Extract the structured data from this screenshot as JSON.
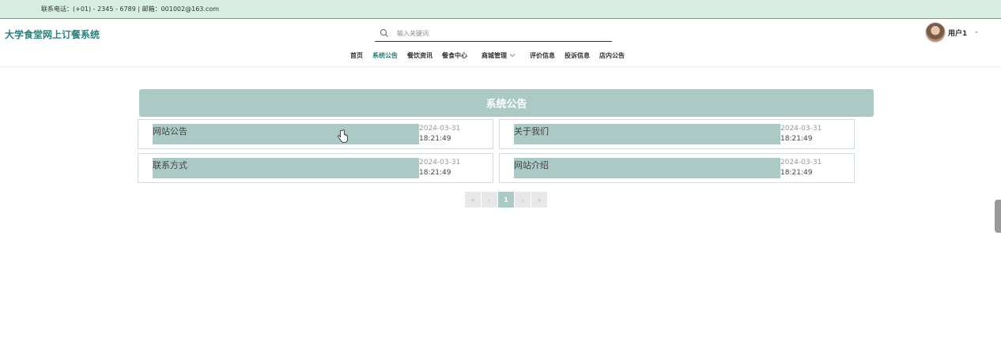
{
  "topbar": {
    "contact": "联系电话：(+01) - 2345 - 6789 | 邮箱：001002@163.com"
  },
  "header": {
    "site_title": "大学食堂网上订餐系统",
    "search_placeholder": "输入关键词",
    "user_name": "用户1",
    "user_caret": "-"
  },
  "nav": {
    "items": [
      {
        "label": "首页"
      },
      {
        "label": "系统公告"
      },
      {
        "label": "餐饮资讯"
      },
      {
        "label": "餐食中心"
      },
      {
        "label": "商城管理"
      },
      {
        "label": "评价信息"
      },
      {
        "label": "投诉信息"
      },
      {
        "label": "店内公告"
      }
    ],
    "active": "系统公告"
  },
  "section": {
    "title": "系统公告"
  },
  "notices": [
    {
      "title": "网站公告",
      "date": "2024-03-31",
      "time": "18:21:49"
    },
    {
      "title": "关于我们",
      "date": "2024-03-31",
      "time": "18:21:49"
    },
    {
      "title": "联系方式",
      "date": "2024-03-31",
      "time": "18:21:49"
    },
    {
      "title": "网站介绍",
      "date": "2024-03-31",
      "time": "18:21:49"
    }
  ],
  "pager": {
    "first": "«",
    "prev": "‹",
    "current": "1",
    "next": "›",
    "last": "»"
  },
  "colors": {
    "accent": "#2a7f7a",
    "bar": "#abc9c5",
    "topbar_bg": "#d8eee3"
  }
}
